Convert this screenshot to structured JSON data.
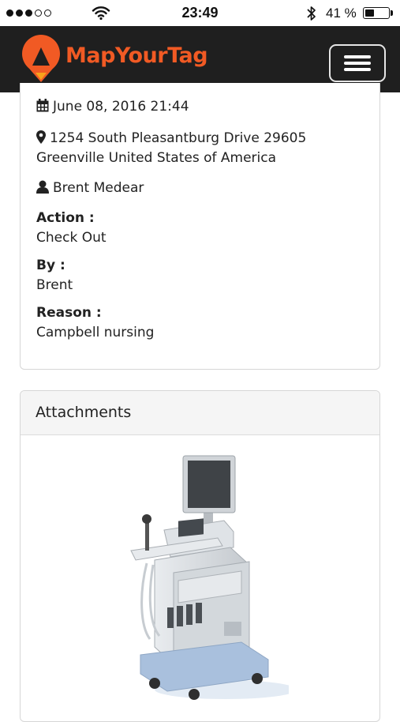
{
  "status_bar": {
    "time": "23:49",
    "battery_percent": "41 %",
    "battery_level": 0.41,
    "signal_bars_filled": 3,
    "signal_bars_total": 5
  },
  "navbar": {
    "brand": "MapYourTag",
    "brand_color": "#f15a24",
    "menu_icon": "hamburger-icon"
  },
  "event": {
    "date": "June 08, 2016 21:44",
    "address_line1": "1254 South Pleasantburg Drive 29605",
    "address_line2": "Greenville United States of America",
    "user": "Brent Medear",
    "action_label": "Action :",
    "action_value": "Check Out",
    "by_label": "By :",
    "by_value": "Brent",
    "reason_label": "Reason :",
    "reason_value": "Campbell nursing"
  },
  "attachments": {
    "title": "Attachments",
    "image_icon": "ultrasound-machine-image"
  }
}
